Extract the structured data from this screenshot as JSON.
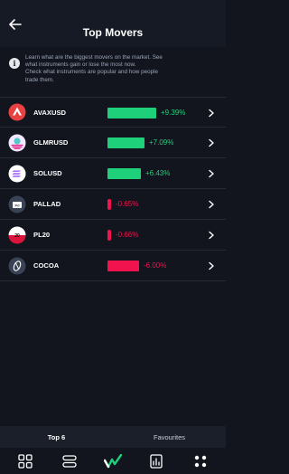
{
  "header": {
    "title": "Top Movers"
  },
  "info": {
    "lines": [
      "Learn what are the biggest movers on the market. See",
      "what instruments gain or lose the most now.",
      "Check what instruments are popular and how people",
      "trade them."
    ]
  },
  "movers": [
    {
      "name": "AVAXUSD",
      "change": "+9.39%",
      "direction": "up",
      "magnitude": 9.39,
      "icon": "avalanche-icon",
      "icon_color": "#e84142"
    },
    {
      "name": "GLMRUSD",
      "change": "+7.09%",
      "direction": "up",
      "magnitude": 7.09,
      "icon": "moonbeam-icon",
      "icon_color": "#e1147b"
    },
    {
      "name": "SOLUSD",
      "change": "+6.43%",
      "direction": "up",
      "magnitude": 6.43,
      "icon": "solana-icon",
      "icon_color": "#9945ff"
    },
    {
      "name": "PALLAD",
      "change": "-0.65%",
      "direction": "down",
      "magnitude": 0.65,
      "icon": "palladium-icon",
      "icon_color": "#3a4256"
    },
    {
      "name": "PL20",
      "change": "-0.66%",
      "direction": "down",
      "magnitude": 0.66,
      "icon": "poland-flag-icon",
      "icon_color": "#dc143c"
    },
    {
      "name": "COCOA",
      "change": "-6.00%",
      "direction": "down",
      "magnitude": 6.0,
      "icon": "cocoa-icon",
      "icon_color": "#3a4256"
    }
  ],
  "tabs": [
    {
      "label": "Top 6",
      "active": true
    },
    {
      "label": "Favourites",
      "active": false
    }
  ],
  "nav": [
    "grid-icon",
    "list-icon",
    "markets-logo-icon",
    "portfolio-icon",
    "more-icon"
  ],
  "colors": {
    "up": "#1fd07a",
    "down": "#f0134d",
    "background": "#12151e"
  }
}
